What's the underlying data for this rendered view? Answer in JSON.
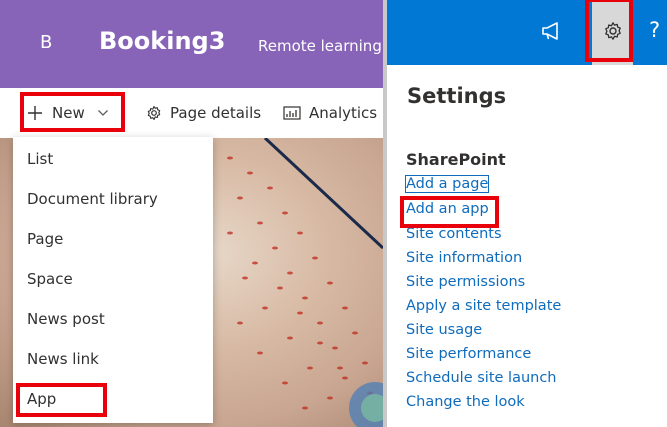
{
  "site": {
    "logo_letter": "B",
    "title": "Booking3",
    "nav_link": "Remote learning"
  },
  "command_bar": {
    "new_label": "New",
    "page_details_label": "Page details",
    "analytics_label": "Analytics"
  },
  "new_menu": {
    "items": [
      "List",
      "Document library",
      "Page",
      "Space",
      "News post",
      "News link",
      "App"
    ]
  },
  "settings_panel": {
    "title": "Settings",
    "section": "SharePoint",
    "links": [
      "Add a page",
      "Add an app",
      "Site contents",
      "Site information",
      "Site permissions",
      "Apply a site template",
      "Site usage",
      "Site performance",
      "Schedule site launch",
      "Change the look"
    ]
  },
  "suite_bar": {
    "help_glyph": "?",
    "icons": [
      "megaphone-icon",
      "gear-icon",
      "help-icon"
    ]
  },
  "colors": {
    "site_header": "#8764b8",
    "suite_bar": "#0078d4",
    "link": "#0f6cbd",
    "highlight": "#e8000b"
  }
}
